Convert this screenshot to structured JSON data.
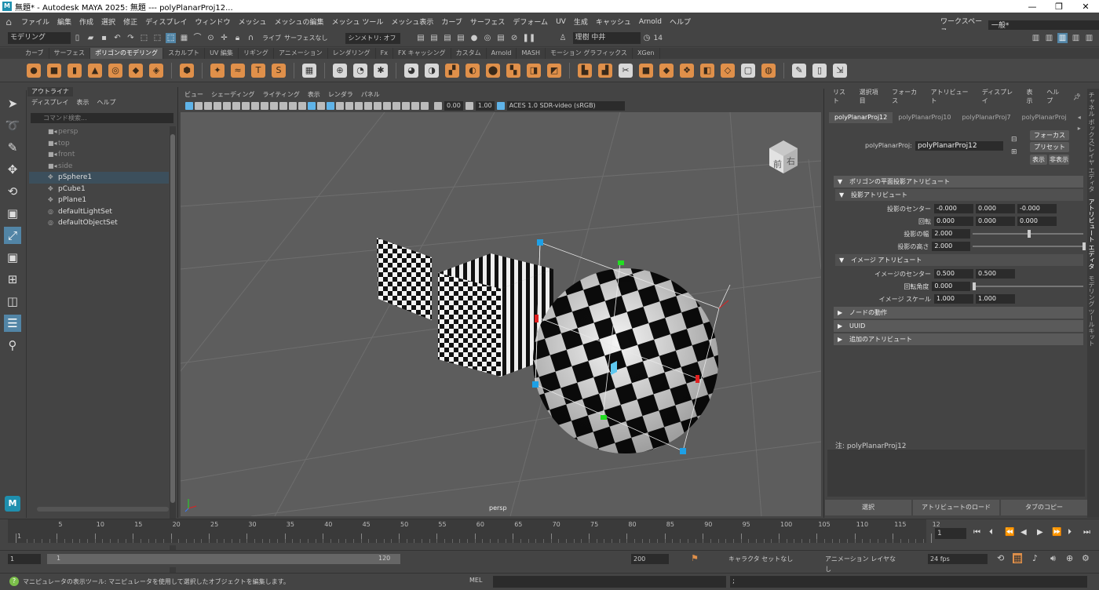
{
  "window": {
    "title": "無題* - Autodesk MAYA 2025: 無題   ---   polyPlanarProj12..."
  },
  "menubar": {
    "items": [
      "ファイル",
      "編集",
      "作成",
      "選択",
      "修正",
      "ディスプレイ",
      "ウィンドウ",
      "メッシュ",
      "メッシュの編集",
      "メッシュ ツール",
      "メッシュ表示",
      "カーブ",
      "サーフェス",
      "デフォーム",
      "UV",
      "生成",
      "キャッシュ",
      "Arnold",
      "ヘルプ"
    ],
    "workspace_label": "ワークスペース :",
    "workspace_value": "一般*"
  },
  "statusline": {
    "mode": "モデリング",
    "live_label": "ライブ",
    "surface_label": "サーフェスなし",
    "symmetry_label": "シンメトリ: オフ",
    "user_name": "理樹 中井",
    "frame_marker": "14"
  },
  "shelf": {
    "tabs": [
      "カーブ",
      "サーフェス",
      "ポリゴンのモデリング",
      "スカルプト",
      "UV 編集",
      "リギング",
      "アニメーション",
      "レンダリング",
      "Fx",
      "FX キャッシング",
      "カスタム",
      "Arnold",
      "MASH",
      "モーション グラフィックス",
      "XGen"
    ],
    "active_tab": 2
  },
  "outliner": {
    "tab_label": "アウトライナ",
    "menu": [
      "ディスプレイ",
      "表示",
      "ヘルプ"
    ],
    "search_placeholder": "コマンド検索...",
    "items": [
      {
        "label": "persp",
        "type": "camera",
        "dim": true
      },
      {
        "label": "top",
        "type": "camera",
        "dim": true
      },
      {
        "label": "front",
        "type": "camera",
        "dim": true
      },
      {
        "label": "side",
        "type": "camera",
        "dim": true
      },
      {
        "label": "pSphere1",
        "type": "mesh",
        "selected": true
      },
      {
        "label": "pCube1",
        "type": "mesh"
      },
      {
        "label": "pPlane1",
        "type": "mesh"
      },
      {
        "label": "defaultLightSet",
        "type": "set"
      },
      {
        "label": "defaultObjectSet",
        "type": "set"
      }
    ]
  },
  "viewport": {
    "menu": [
      "ビュー",
      "シェーディング",
      "ライティング",
      "表示",
      "レンダラ",
      "パネル"
    ],
    "exposure": "0.00",
    "gamma": "1.00",
    "colorspace": "ACES 1.0 SDR-video (sRGB)",
    "camera_label": "persp",
    "viewcube_front": "前",
    "viewcube_right": "右"
  },
  "attribute_editor": {
    "menu": [
      "リスト",
      "選択項目",
      "フォーカス",
      "アトリビュート",
      "ディスプレイ",
      "表示",
      "ヘルプ"
    ],
    "node_tabs": [
      "polyPlanarProj12",
      "polyPlanarProj10",
      "polyPlanarProj7",
      "polyPlanarProj"
    ],
    "node_label": "polyPlanarProj:",
    "node_value": "polyPlanarProj12",
    "btn_focus": "フォーカス",
    "btn_preset": "プリセット",
    "btn_show": "表示",
    "btn_hide": "非表示",
    "sections": {
      "main": "ポリゴンの平面投影アトリビュート",
      "proj": "投影アトリビュート",
      "image": "イメージ アトリビュート",
      "node_behavior": "ノードの動作",
      "uuid": "UUID",
      "extra": "追加のアトリビュート"
    },
    "proj_center_label": "投影のセンター",
    "proj_center": [
      "-0.000",
      "0.000",
      "-0.000"
    ],
    "rotate_label": "回転",
    "rotate": [
      "0.000",
      "0.000",
      "0.000"
    ],
    "proj_width_label": "投影の幅",
    "proj_width": "2.000",
    "proj_height_label": "投影の高さ",
    "proj_height": "2.000",
    "image_center_label": "イメージのセンター",
    "image_center": [
      "0.500",
      "0.500"
    ],
    "rot_angle_label": "回転角度",
    "rot_angle": "0.000",
    "image_scale_label": "イメージ スケール",
    "image_scale": [
      "1.000",
      "1.000"
    ],
    "notes_label": "注:  polyPlanarProj12",
    "bottom_buttons": [
      "選択",
      "アトリビュートのロード",
      "タブのコピー"
    ]
  },
  "side_tabs": [
    "チャネル ボックス/レイヤ エディタ",
    "アトリビュート エディタ",
    "モデリング ツールキット"
  ],
  "time": {
    "ticks": [
      "1",
      "5",
      "10",
      "15",
      "20",
      "25",
      "30",
      "35",
      "40",
      "45",
      "50",
      "55",
      "60",
      "65",
      "70",
      "75",
      "80",
      "85",
      "90",
      "95",
      "100",
      "105",
      "110",
      "115",
      "12"
    ],
    "current": "1",
    "range_start": "1",
    "range_inner_start": "1",
    "range_inner_end": "120",
    "range_end": "200",
    "character_set": "キャラクタ セットなし",
    "anim_layer": "アニメーション レイヤなし",
    "fps": "24 fps"
  },
  "cmdline": {
    "help": "マニピュレータの表示ツール: マニピュレータを使用して選択したオブジェクトを編集します。",
    "mel_label": "MEL",
    "result": ";"
  },
  "colors": {
    "accent": "#5285a6",
    "shelf_icon": "#e0904a",
    "viewport_bg": "#5d5d5d",
    "manip_cyan": "#1ea0e6"
  }
}
